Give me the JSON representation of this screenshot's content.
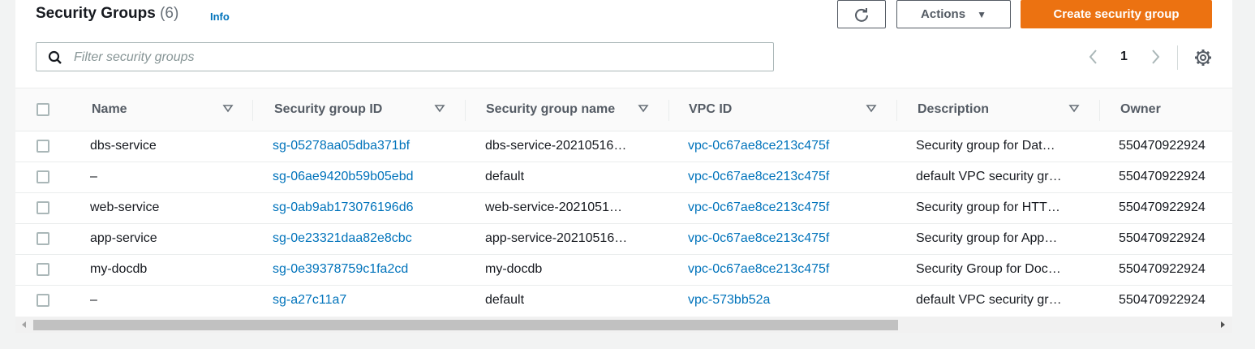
{
  "header": {
    "title": "Security Groups",
    "count": "(6)",
    "info_label": "Info"
  },
  "toolbar": {
    "refresh_icon": "refresh-icon",
    "actions_label": "Actions",
    "create_label": "Create security group"
  },
  "search": {
    "placeholder": "Filter security groups",
    "value": ""
  },
  "pagination": {
    "current_page": "1"
  },
  "colors": {
    "primary": "#ec7211",
    "link": "#0073bb"
  },
  "table": {
    "columns": [
      "Name",
      "Security group ID",
      "Security group name",
      "VPC ID",
      "Description",
      "Owner"
    ],
    "rows": [
      {
        "name": "dbs-service",
        "id": "sg-05278aa05dba371bf",
        "group_name": "dbs-service-20210516…",
        "vpc": "vpc-0c67ae8ce213c475f",
        "description": "Security group for Dat…",
        "owner": "550470922924"
      },
      {
        "name": "–",
        "id": "sg-06ae9420b59b05ebd",
        "group_name": "default",
        "vpc": "vpc-0c67ae8ce213c475f",
        "description": "default VPC security gr…",
        "owner": "550470922924"
      },
      {
        "name": "web-service",
        "id": "sg-0ab9ab173076196d6",
        "group_name": "web-service-2021051…",
        "vpc": "vpc-0c67ae8ce213c475f",
        "description": "Security group for HTT…",
        "owner": "550470922924"
      },
      {
        "name": "app-service",
        "id": "sg-0e23321daa82e8cbc",
        "group_name": "app-service-20210516…",
        "vpc": "vpc-0c67ae8ce213c475f",
        "description": "Security group for App…",
        "owner": "550470922924"
      },
      {
        "name": "my-docdb",
        "id": "sg-0e39378759c1fa2cd",
        "group_name": "my-docdb",
        "vpc": "vpc-0c67ae8ce213c475f",
        "description": "Security Group for Doc…",
        "owner": "550470922924"
      },
      {
        "name": "–",
        "id": "sg-a27c11a7",
        "group_name": "default",
        "vpc": "vpc-573bb52a",
        "description": "default VPC security gr…",
        "owner": "550470922924"
      }
    ]
  }
}
